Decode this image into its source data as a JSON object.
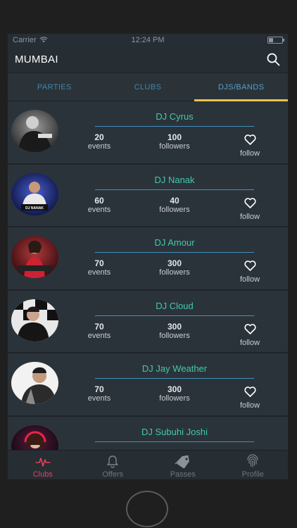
{
  "status_bar": {
    "carrier": "Carrier",
    "time": "12:24 PM"
  },
  "header": {
    "city": "MUMBAI"
  },
  "tabs": [
    {
      "label": "PARTIES",
      "active": false
    },
    {
      "label": "CLUBS",
      "active": false
    },
    {
      "label": "DJS/BANDS",
      "active": true
    }
  ],
  "djs": [
    {
      "name": "DJ Cyrus",
      "events": "20",
      "events_label": "events",
      "followers": "100",
      "followers_label": "followers",
      "follow_label": "follow"
    },
    {
      "name": "DJ Nanak",
      "events": "60",
      "events_label": "events",
      "followers": "40",
      "followers_label": "followers",
      "follow_label": "follow",
      "avatar_text": "DJ NANAK"
    },
    {
      "name": "DJ Amour",
      "events": "70",
      "events_label": "events",
      "followers": "300",
      "followers_label": "followers",
      "follow_label": "follow"
    },
    {
      "name": "DJ Cloud",
      "events": "70",
      "events_label": "events",
      "followers": "300",
      "followers_label": "followers",
      "follow_label": "follow"
    },
    {
      "name": "DJ Jay Weather",
      "events": "70",
      "events_label": "events",
      "followers": "300",
      "followers_label": "followers",
      "follow_label": "follow"
    },
    {
      "name": "DJ Subuhi Joshi",
      "events": "",
      "events_label": "",
      "followers": "",
      "followers_label": "",
      "follow_label": ""
    }
  ],
  "bottom_nav": [
    {
      "label": "Clubs",
      "icon": "pulse-icon",
      "active": true
    },
    {
      "label": "Offers",
      "icon": "bell-icon",
      "active": false
    },
    {
      "label": "Passes",
      "icon": "tag-icon",
      "active": false
    },
    {
      "label": "Profile",
      "icon": "fingerprint-icon",
      "active": false
    }
  ],
  "colors": {
    "accent_green": "#41c9a8",
    "accent_blue": "#4da3d3",
    "tab_underline": "#e8c44a",
    "active_nav": "#e0425a"
  }
}
